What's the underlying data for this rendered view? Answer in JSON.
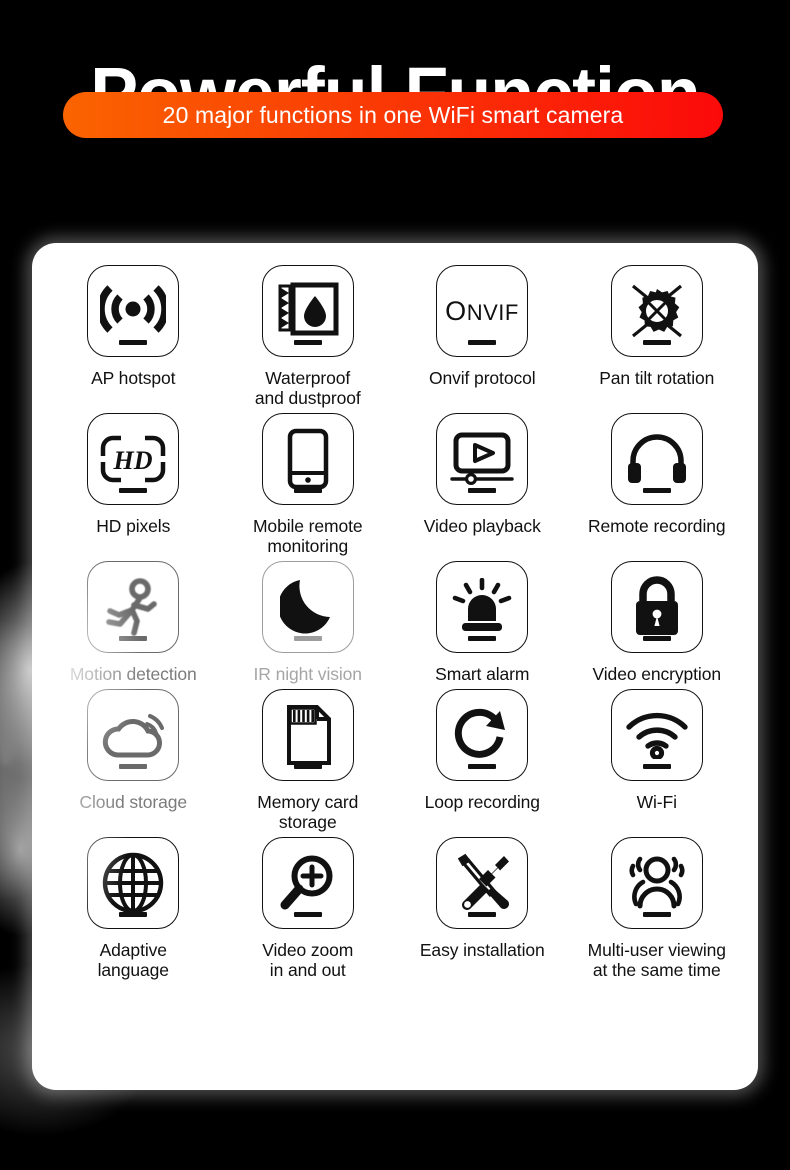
{
  "header": {
    "title": "Powerful Function",
    "subtitle": "20 major functions in one WiFi smart camera",
    "pill_color_start": "#FA6400",
    "pill_color_end": "#FB0A0A",
    "title_color": "#FFFFFF",
    "background_color": "#000000"
  },
  "panel": {
    "background_color": "#FFFFFF",
    "border_radius": "24px"
  },
  "features": [
    {
      "label": "AP hotspot",
      "icon": "ap-hotspot-icon"
    },
    {
      "label": "Waterproof\nand dustproof",
      "icon": "waterproof-dustproof-icon"
    },
    {
      "label": "Onvif protocol",
      "icon": "onvif-logo-icon"
    },
    {
      "label": "Pan tilt rotation",
      "icon": "pan-tilt-rotation-icon"
    },
    {
      "label": "HD pixels",
      "icon": "hd-pixels-icon"
    },
    {
      "label": "Mobile remote\nmonitoring",
      "icon": "mobile-phone-icon"
    },
    {
      "label": "Video playback",
      "icon": "video-playback-icon"
    },
    {
      "label": "Remote recording",
      "icon": "headphones-icon"
    },
    {
      "label": "Motion detection",
      "icon": "running-person-icon"
    },
    {
      "label": "IR night vision",
      "icon": "crescent-moon-icon"
    },
    {
      "label": "Smart alarm",
      "icon": "siren-alarm-icon"
    },
    {
      "label": "Video encryption",
      "icon": "padlock-icon"
    },
    {
      "label": "Cloud storage",
      "icon": "cloud-storage-icon"
    },
    {
      "label": "Memory card\nstorage",
      "icon": "sd-memory-card-icon"
    },
    {
      "label": "Loop recording",
      "icon": "loop-arrow-icon"
    },
    {
      "label": "Wi-Fi",
      "icon": "wifi-icon"
    },
    {
      "label": "Adaptive\nlanguage",
      "icon": "globe-icon"
    },
    {
      "label": "Video zoom\nin and out",
      "icon": "magnifier-plus-icon"
    },
    {
      "label": "Easy installation",
      "icon": "wrench-screwdriver-icon"
    },
    {
      "label": "Multi-user viewing\nat the same time",
      "icon": "multi-user-icon"
    }
  ]
}
